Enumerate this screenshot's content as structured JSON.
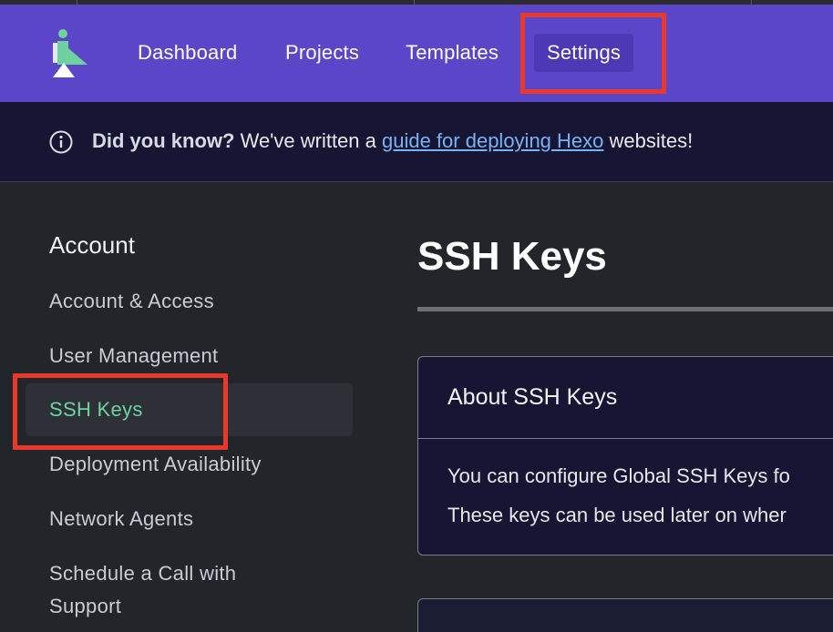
{
  "nav": {
    "items": [
      {
        "label": "Dashboard"
      },
      {
        "label": "Projects"
      },
      {
        "label": "Templates"
      },
      {
        "label": "Settings",
        "active": true
      }
    ]
  },
  "banner": {
    "icon": "info-icon",
    "bold": "Did you know?",
    "text_before": "We've written a",
    "link": "guide for deploying Hexo",
    "text_after": "websites!"
  },
  "sidebar": {
    "heading": "Account",
    "items": [
      {
        "label": "Account & Access"
      },
      {
        "label": "User Management"
      },
      {
        "label": "SSH Keys",
        "active": true
      },
      {
        "label": "Deployment Availability"
      },
      {
        "label": "Network Agents"
      },
      {
        "label": "Schedule a Call with"
      },
      {
        "label": "Support"
      }
    ]
  },
  "main": {
    "title": "SSH Keys",
    "card": {
      "title": "About SSH Keys",
      "line1": "You can configure Global SSH Keys fo",
      "line2": "These keys can be used later on wher"
    }
  },
  "colors": {
    "nav_bg": "#5b45c9",
    "banner_bg": "#161634",
    "page_bg": "#22262b",
    "active_green": "#6fd0a0",
    "highlight_red": "#e8392b",
    "link_blue": "#7ab1f2"
  }
}
